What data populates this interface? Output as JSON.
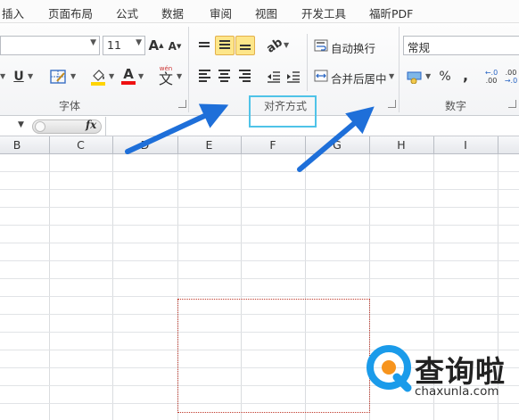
{
  "menu": [
    "插入",
    "页面布局",
    "公式",
    "数据",
    "审阅",
    "视图",
    "开发工具",
    "福昕PDF"
  ],
  "font_group": {
    "size_value": "11",
    "grow_icon": "A",
    "shrink_icon": "A",
    "underline_icon": "U",
    "font_color_icon": "A",
    "wen_icon": "文",
    "label": "字体"
  },
  "align_group": {
    "wrap_label": "自动换行",
    "merge_label": "合并后居中",
    "label": "对齐方式"
  },
  "number_group": {
    "format_value": "常规",
    "percent_icon": "%",
    "comma_icon": ",",
    "label": "数字"
  },
  "formula_bar": {
    "fx": "fx"
  },
  "columns": [
    "B",
    "C",
    "D",
    "E",
    "F",
    "G",
    "H",
    "I"
  ],
  "watermark": {
    "brand": "查询啦",
    "url": "chaxunla.com"
  },
  "colors": {
    "arrow": "#1e6fd9",
    "highlight": "#4fc3e8",
    "marquee": "#c0392b",
    "active_button": "#fde68a"
  }
}
